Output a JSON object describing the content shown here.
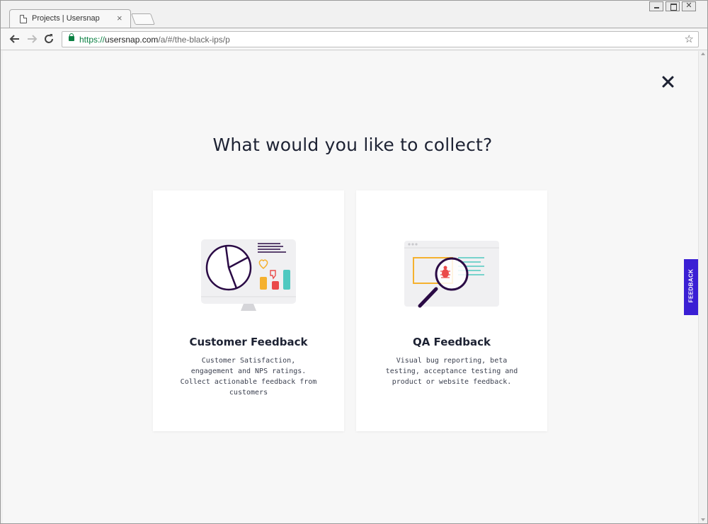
{
  "browser": {
    "tab_title": "Projects | Usersnap",
    "tab_close": "×",
    "url_scheme": "https://",
    "url_host": "usersnap.com",
    "url_path": "/a/#/the-black-ips/p",
    "back_icon": "arrow-left-icon",
    "forward_icon": "arrow-right-icon",
    "reload_icon": "reload-icon",
    "bookmark_icon": "star-icon",
    "secure_color": "#0b8043"
  },
  "page": {
    "heading": "What would you like to collect?",
    "close_icon": "close-icon",
    "cards": [
      {
        "title": "Customer Feedback",
        "description": "Customer Satisfaction, engagement and NPS ratings. Collect actionable feedback from customers",
        "icon": "monitor-chart-icon"
      },
      {
        "title": "QA Feedback",
        "description": "Visual bug reporting, beta testing, acceptance testing and product or website feedback.",
        "icon": "magnifier-bug-icon"
      }
    ]
  },
  "widget": {
    "feedback_label": "FEEDBACK",
    "color": "#3a1fd4"
  },
  "colors": {
    "accent_purple": "#2a0a45",
    "accent_teal": "#4fc9c0",
    "accent_orange": "#f5b12f",
    "accent_red": "#ea4a4a",
    "text_dark": "#1d2233"
  }
}
